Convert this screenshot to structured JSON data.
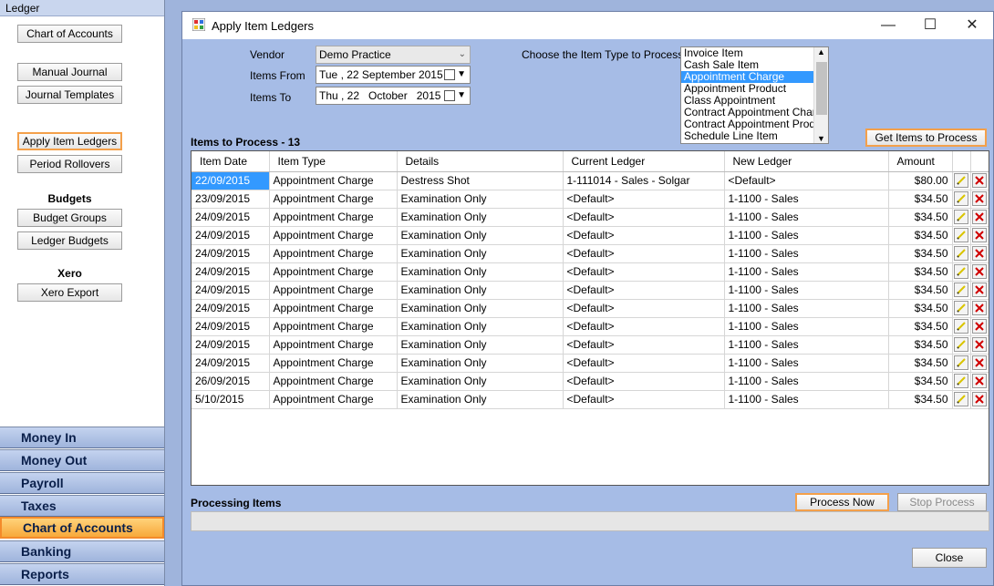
{
  "sidebar": {
    "header": "Ledger",
    "buttons": {
      "chart_of_accounts": "Chart of Accounts",
      "manual_journal": "Manual Journal",
      "journal_templates": "Journal Templates",
      "apply_item_ledgers": "Apply Item Ledgers",
      "period_rollovers": "Period Rollovers",
      "budget_groups": "Budget Groups",
      "ledger_budgets": "Ledger Budgets",
      "xero_export": "Xero Export"
    },
    "sections": {
      "budgets": "Budgets",
      "xero": "Xero"
    },
    "nav": {
      "money_in": "Money In",
      "money_out": "Money Out",
      "payroll": "Payroll",
      "taxes": "Taxes",
      "chart_of_accounts": "Chart of Accounts",
      "banking": "Banking",
      "reports": "Reports"
    }
  },
  "dialog": {
    "title": "Apply Item Ledgers",
    "window_controls": {
      "minimize": "—",
      "maximize": "☐",
      "close": "✕"
    },
    "vendor_label": "Vendor",
    "vendor_value": "Demo Practice",
    "items_from_label": "Items From",
    "items_from_value": "Tue , 22 September 2015",
    "items_to_label": "Items To",
    "items_to_value": "Thu , 22   October   2015",
    "item_type_label": "Choose the Item Type to Process",
    "item_types": [
      "Invoice Item",
      "Cash Sale Item",
      "Appointment Charge",
      "Appointment Product",
      "Class Appointment",
      "Contract Appointment Charge",
      "Contract Appointment Product",
      "Schedule Line Item"
    ],
    "selected_item_type": "Appointment Charge",
    "get_items_button": "Get Items to Process",
    "items_to_process_label": "Items to Process - 13",
    "columns": {
      "item_date": "Item Date",
      "item_type": "Item Type",
      "details": "Details",
      "current_ledger": "Current Ledger",
      "new_ledger": "New Ledger",
      "amount": "Amount"
    },
    "rows": [
      {
        "date": "22/09/2015",
        "type": "Appointment Charge",
        "details": "Destress Shot",
        "current": "1-111014 - Sales - Solgar",
        "new": "<Default>",
        "amount": "$80.00"
      },
      {
        "date": "23/09/2015",
        "type": "Appointment Charge",
        "details": "Examination Only",
        "current": "<Default>",
        "new": "1-1100 - Sales",
        "amount": "$34.50"
      },
      {
        "date": "24/09/2015",
        "type": "Appointment Charge",
        "details": "Examination Only",
        "current": "<Default>",
        "new": "1-1100 - Sales",
        "amount": "$34.50"
      },
      {
        "date": "24/09/2015",
        "type": "Appointment Charge",
        "details": "Examination Only",
        "current": "<Default>",
        "new": "1-1100 - Sales",
        "amount": "$34.50"
      },
      {
        "date": "24/09/2015",
        "type": "Appointment Charge",
        "details": "Examination Only",
        "current": "<Default>",
        "new": "1-1100 - Sales",
        "amount": "$34.50"
      },
      {
        "date": "24/09/2015",
        "type": "Appointment Charge",
        "details": "Examination Only",
        "current": "<Default>",
        "new": "1-1100 - Sales",
        "amount": "$34.50"
      },
      {
        "date": "24/09/2015",
        "type": "Appointment Charge",
        "details": "Examination Only",
        "current": "<Default>",
        "new": "1-1100 - Sales",
        "amount": "$34.50"
      },
      {
        "date": "24/09/2015",
        "type": "Appointment Charge",
        "details": "Examination Only",
        "current": "<Default>",
        "new": "1-1100 - Sales",
        "amount": "$34.50"
      },
      {
        "date": "24/09/2015",
        "type": "Appointment Charge",
        "details": "Examination Only",
        "current": "<Default>",
        "new": "1-1100 - Sales",
        "amount": "$34.50"
      },
      {
        "date": "24/09/2015",
        "type": "Appointment Charge",
        "details": "Examination Only",
        "current": "<Default>",
        "new": "1-1100 - Sales",
        "amount": "$34.50"
      },
      {
        "date": "24/09/2015",
        "type": "Appointment Charge",
        "details": "Examination Only",
        "current": "<Default>",
        "new": "1-1100 - Sales",
        "amount": "$34.50"
      },
      {
        "date": "26/09/2015",
        "type": "Appointment Charge",
        "details": "Examination Only",
        "current": "<Default>",
        "new": "1-1100 - Sales",
        "amount": "$34.50"
      },
      {
        "date": "5/10/2015",
        "type": "Appointment Charge",
        "details": "Examination Only",
        "current": "<Default>",
        "new": "1-1100 - Sales",
        "amount": "$34.50"
      }
    ],
    "processing_label": "Processing Items",
    "process_now_button": "Process Now",
    "stop_process_button": "Stop Process",
    "close_button": "Close"
  },
  "colors": {
    "background": "#9fb4dc",
    "dialog_bg": "#a6bce6",
    "highlight_orange": "#f4a04a",
    "selection_blue": "#3399ff",
    "delete_red": "#d00000",
    "edit_yellow": "#d9c400"
  },
  "icons": {
    "edit": "pencil-icon",
    "delete": "delete-x-icon",
    "calendar": "calendar-icon",
    "app": "app-window-icon"
  }
}
